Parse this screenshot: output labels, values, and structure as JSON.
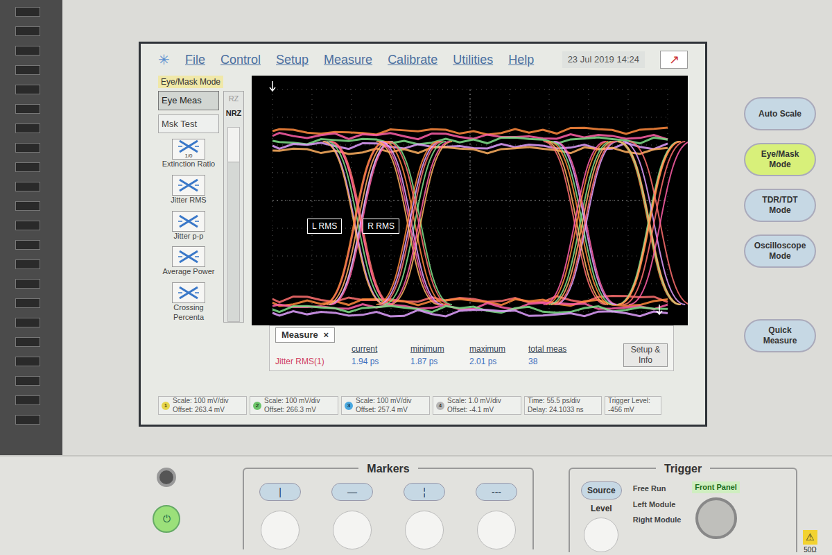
{
  "menu": {
    "items": [
      "File",
      "Control",
      "Setup",
      "Measure",
      "Calibrate",
      "Utilities",
      "Help"
    ],
    "datetime": "23 Jul 2019 14:24"
  },
  "left_panel": {
    "mode_label": "Eye/Mask Mode",
    "tabs": [
      {
        "label": "Eye Meas",
        "selected": true
      },
      {
        "label": "Msk Test",
        "selected": false
      }
    ],
    "coding": [
      {
        "label": "RZ",
        "selected": false
      },
      {
        "label": "NRZ",
        "selected": true
      }
    ],
    "measurements": [
      {
        "label": "Extinction Ratio",
        "glyph": "1/0"
      },
      {
        "label": "Jitter RMS",
        "glyph": ""
      },
      {
        "label": "Jitter p-p",
        "glyph": ""
      },
      {
        "label": "Average Power",
        "glyph": ""
      },
      {
        "label": "Crossing Percenta",
        "glyph": ""
      }
    ]
  },
  "display": {
    "markers": [
      "L RMS",
      "R RMS"
    ]
  },
  "measure": {
    "title": "Measure",
    "close": "×",
    "columns": [
      "current",
      "minimum",
      "maximum",
      "total meas"
    ],
    "rows": [
      {
        "name": "Jitter RMS(1)",
        "values": [
          "1.94 ps",
          "1.87 ps",
          "2.01 ps",
          "38"
        ]
      }
    ],
    "setup_button": "Setup & Info"
  },
  "channels": [
    {
      "number": "1",
      "scale": "Scale: 100 mV/div",
      "offset": "Offset: 263.4 mV",
      "color": "#e6d54a"
    },
    {
      "number": "2",
      "scale": "Scale: 100 mV/div",
      "offset": "Offset: 266.3 mV",
      "color": "#6cc46a"
    },
    {
      "number": "3",
      "scale": "Scale: 100 mV/div",
      "offset": "Offset: 257.4 mV",
      "color": "#4aa8e0"
    },
    {
      "number": "4",
      "scale": "Scale: 1.0 mV/div",
      "offset": "Offset: -4.1 mV",
      "color": "#b5b5b5"
    }
  ],
  "timebase": {
    "time": "Time: 55.5 ps/div",
    "delay": "Delay: 24.1033 ns"
  },
  "trigger_level": {
    "label": "Trigger Level:",
    "value": "-456 mV"
  },
  "front_buttons": [
    {
      "label": "Auto Scale",
      "lit": false
    },
    {
      "label": "Eye/Mask Mode",
      "lit": true
    },
    {
      "label": "TDR/TDT Mode",
      "lit": false
    },
    {
      "label": "Oscilloscope Mode",
      "lit": false
    },
    {
      "label": "Quick Measure",
      "lit": false
    }
  ],
  "markers_panel": {
    "title": "Markers",
    "buttons": [
      "|",
      "—",
      "¦",
      "---"
    ]
  },
  "trigger_panel": {
    "title": "Trigger",
    "source": "Source",
    "level": "Level",
    "options": [
      {
        "label": "Free Run",
        "selected": false
      },
      {
        "label": "Left Module",
        "selected": false
      },
      {
        "label": "Right Module",
        "selected": false
      },
      {
        "label": "Front Panel",
        "selected": true
      }
    ]
  },
  "connector_label": "50Ω"
}
